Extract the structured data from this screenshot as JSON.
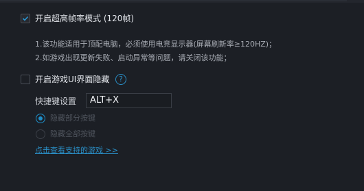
{
  "settings": {
    "high_fps": {
      "checked": true,
      "label": "开启超高帧率模式 (120帧)",
      "notes": [
        "1.该功能适用于顶配电脑，必须使用电竞显示器(屏幕刷新率≥120HZ)；",
        "2.如游戏出现更新失败、启动异常等问题，请关闭该功能；"
      ]
    },
    "hide_ui": {
      "checked": false,
      "label": "开启游戏UI界面隐藏",
      "help_icon": "question-icon",
      "help_glyph": "?",
      "hotkey_label": "快捷键设置",
      "hotkey_value": "ALT+X",
      "options": [
        {
          "label": "隐藏部分按键",
          "selected": true
        },
        {
          "label": "隐藏全部按键",
          "selected": false
        }
      ],
      "link_text": "点击查看支持的游戏 >>"
    }
  },
  "colors": {
    "background": "#1c1f25",
    "accent": "#1f8ec8",
    "text": "#e3e6eb",
    "muted": "#a7abb3",
    "disabled": "#4e535c"
  }
}
